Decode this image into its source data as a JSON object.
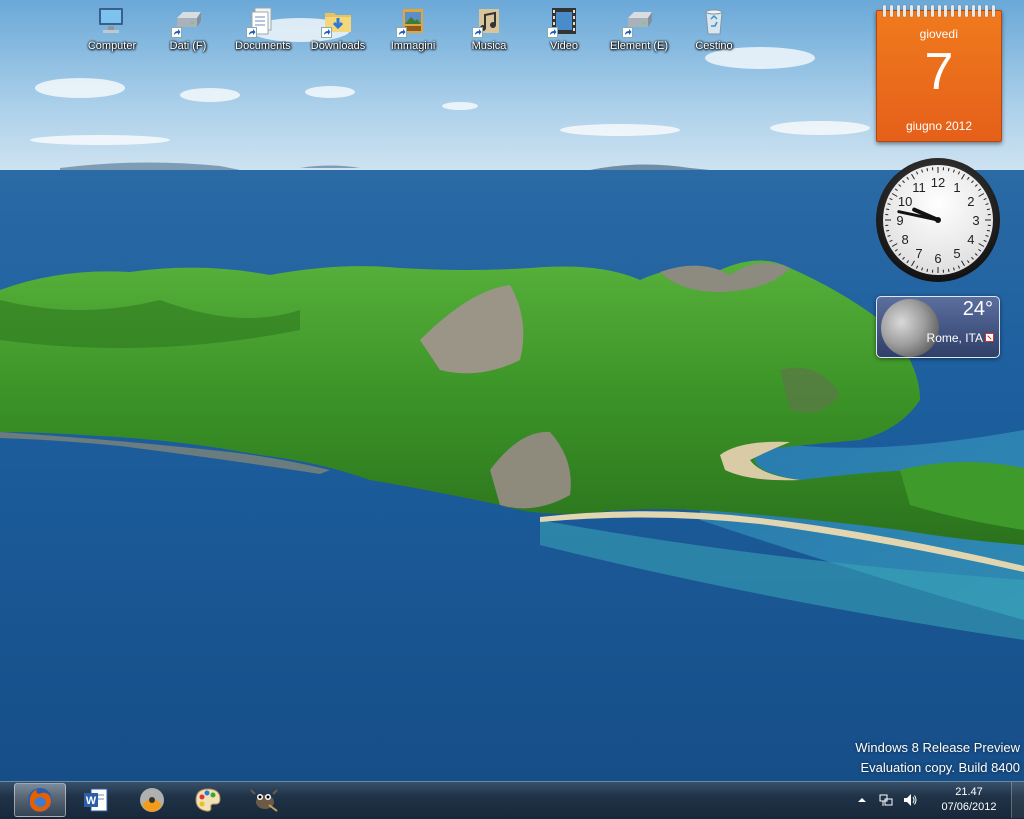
{
  "desktop": {
    "icons": [
      {
        "label": "Computer",
        "icon": "computer-icon",
        "shortcut": false
      },
      {
        "label": "Dati (F)",
        "icon": "drive-icon",
        "shortcut": true
      },
      {
        "label": "Documents",
        "icon": "documents-library-icon",
        "shortcut": true
      },
      {
        "label": "Downloads",
        "icon": "downloads-folder-icon",
        "shortcut": true
      },
      {
        "label": "Immagini",
        "icon": "pictures-library-icon",
        "shortcut": true
      },
      {
        "label": "Musica",
        "icon": "music-library-icon",
        "shortcut": true
      },
      {
        "label": "Video",
        "icon": "videos-library-icon",
        "shortcut": true
      },
      {
        "label": "Element (E)",
        "icon": "drive-icon",
        "shortcut": true
      },
      {
        "label": "Cestino",
        "icon": "recycle-bin-icon",
        "shortcut": false
      }
    ]
  },
  "gadgets": {
    "calendar": {
      "weekday": "giovedì",
      "day": "7",
      "month_year": "giugno 2012"
    },
    "clock": {
      "numerals": [
        "12",
        "1",
        "2",
        "3",
        "4",
        "5",
        "6",
        "7",
        "8",
        "9",
        "10",
        "11"
      ],
      "time": "21:47"
    },
    "weather": {
      "temperature": "24°",
      "city": "Rome, ITA",
      "icon": "moon-icon"
    }
  },
  "watermark": {
    "line1": "Windows 8 Release Preview",
    "line2": "Evaluation copy. Build 8400"
  },
  "taskbar": {
    "apps": [
      {
        "name": "Firefox",
        "icon": "firefox-icon",
        "active": true
      },
      {
        "name": "Microsoft Word",
        "icon": "word-icon",
        "active": false
      },
      {
        "name": "Disc burner",
        "icon": "disc-burner-icon",
        "active": false
      },
      {
        "name": "Paint",
        "icon": "paint-palette-icon",
        "active": false
      },
      {
        "name": "GIMP",
        "icon": "gimp-icon",
        "active": false
      }
    ],
    "tray": {
      "time": "21.47",
      "date": "07/06/2012",
      "icons": [
        "show-hidden-icons-arrow-icon",
        "network-icon",
        "volume-icon"
      ]
    }
  },
  "colors": {
    "calendar_orange": "#e8661b",
    "taskbar": "#1f3246",
    "sea": "#1d5d9c",
    "island_green": "#3c9a2a"
  }
}
